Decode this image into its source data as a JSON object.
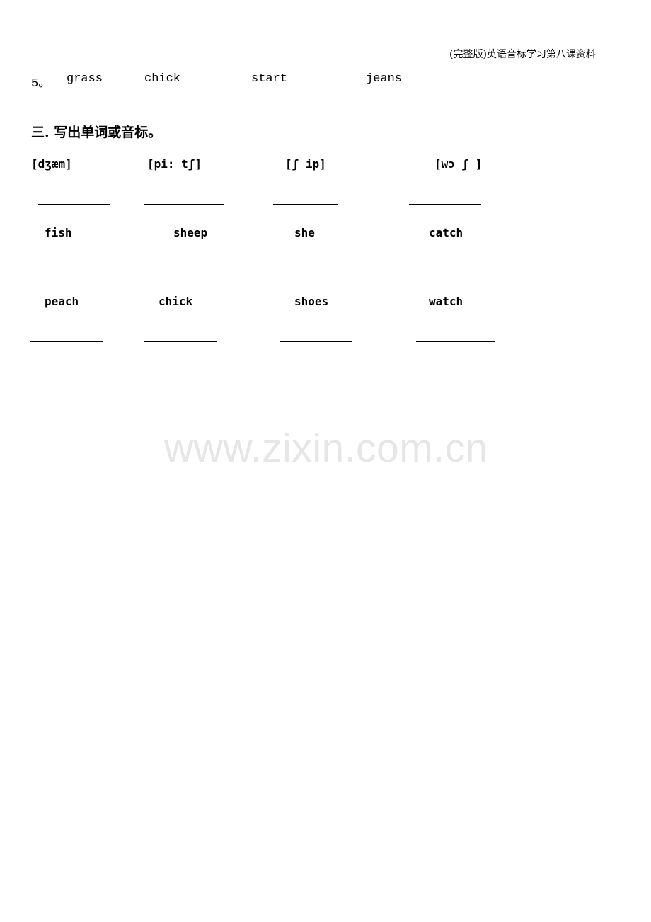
{
  "header": {
    "title": "(完整版)英语音标学习第八课资料"
  },
  "row5": {
    "number": "5。",
    "words": [
      "grass",
      "chick",
      "start",
      "jeans"
    ]
  },
  "section3": {
    "heading": "三. 写出单词或音标。",
    "phonetics": [
      "[dʒæm]",
      "[pi: tʃ]",
      "[ʃ ip]",
      "[wɔ ʃ ]"
    ],
    "words_row1": [
      "fish",
      "sheep",
      "she",
      "catch"
    ],
    "words_row2": [
      "peach",
      "chick",
      "shoes",
      "watch"
    ]
  },
  "watermark": "www.zixin.com.cn"
}
